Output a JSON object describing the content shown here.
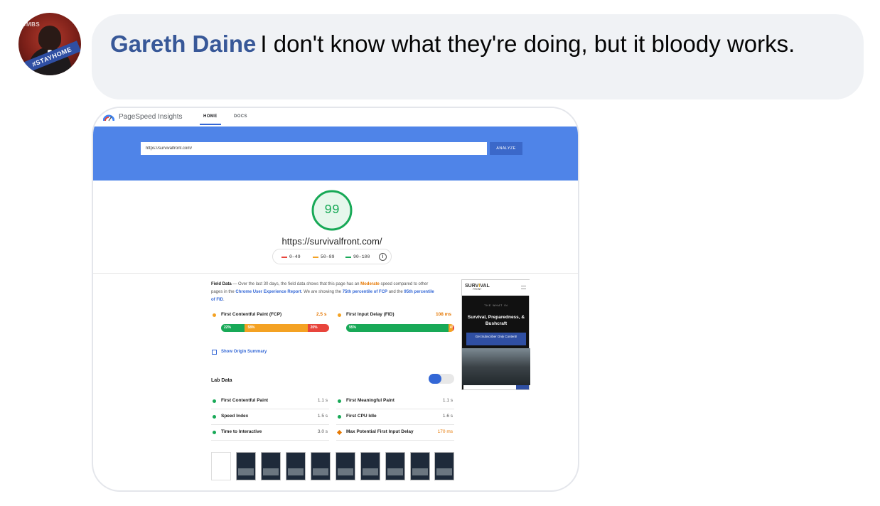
{
  "comment": {
    "author": "Gareth Daine",
    "text": "I don't know what they're doing, but it bloody works.",
    "avatar": {
      "badge_text": "#STAYHOME",
      "top_text": "#MBS"
    }
  },
  "psi": {
    "brand": "PageSpeed Insights",
    "tabs": [
      "HOME",
      "DOCS"
    ],
    "url_value": "https://survivalfront.com/",
    "analyze_label": "ANALYZE",
    "score": "99",
    "score_url": "https://survivalfront.com/",
    "legend": [
      {
        "label": "0–49",
        "color": "#e8453c"
      },
      {
        "label": "50–89",
        "color": "#f4a223"
      },
      {
        "label": "90–100",
        "color": "#18a957"
      }
    ],
    "field": {
      "title": "Field Data",
      "desc_1": "— Over the last 30 days, the field data shows that this page has an",
      "speed": "Moderate",
      "desc_2": "speed compared to other pages in the",
      "report": "Chrome User Experience Report",
      "desc_3": ". We are showing the",
      "pct1": "75th percentile of FCP",
      "desc_4": "and the",
      "pct2": "95th percentile of FID",
      "fcp": {
        "label": "First Contentful Paint (FCP)",
        "value": "2.5 s",
        "dist": [
          "22%",
          "58%",
          "20%"
        ],
        "dist_values": [
          22,
          58,
          20
        ]
      },
      "fid": {
        "label": "First Input Delay (FID)",
        "value": "108 ms",
        "dist": [
          "95%",
          "4%",
          "1%"
        ],
        "dist_values": [
          95,
          4,
          1
        ]
      },
      "origin_label": "Show Origin Summary"
    },
    "lab": {
      "title": "Lab Data",
      "rows_left": [
        {
          "name": "First Contentful Paint",
          "value": "1.1 s"
        },
        {
          "name": "Speed Index",
          "value": "1.5 s"
        },
        {
          "name": "Time to Interactive",
          "value": "3.0 s"
        }
      ],
      "rows_right": [
        {
          "name": "First Meaningful Paint",
          "value": "1.1 s"
        },
        {
          "name": "First CPU Idle",
          "value": "1.6 s"
        },
        {
          "name": "Max Potential First Input Delay",
          "value": "170 ms"
        }
      ]
    },
    "phone": {
      "logo_a": "SURV",
      "logo_v": "I",
      "logo_b": "VAL",
      "logo_sub": "FRONT",
      "sub": "THE WHAT IN",
      "headline": "Survival, Preparedness, & Bushcraft",
      "button": "Get Subscriber Only Content!"
    }
  }
}
